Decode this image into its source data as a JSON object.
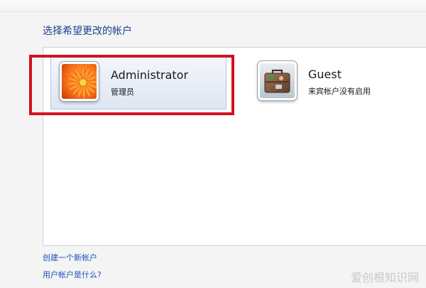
{
  "page": {
    "title": "选择希望更改的帐户"
  },
  "accounts": [
    {
      "name": "Administrator",
      "description": "管理员",
      "picture": "orange-flower",
      "selected": true
    },
    {
      "name": "Guest",
      "description": "来宾帐户没有启用",
      "picture": "suitcase"
    }
  ],
  "links": {
    "create_account": "创建一个新帐户",
    "what_is_account": "用户帐户是什么?"
  },
  "watermark": "爱创根知识网",
  "colors": {
    "title": "#1e3f8f",
    "link": "#1e52b8",
    "highlight": "#d21220",
    "selected_tile": "#dde6f3"
  }
}
